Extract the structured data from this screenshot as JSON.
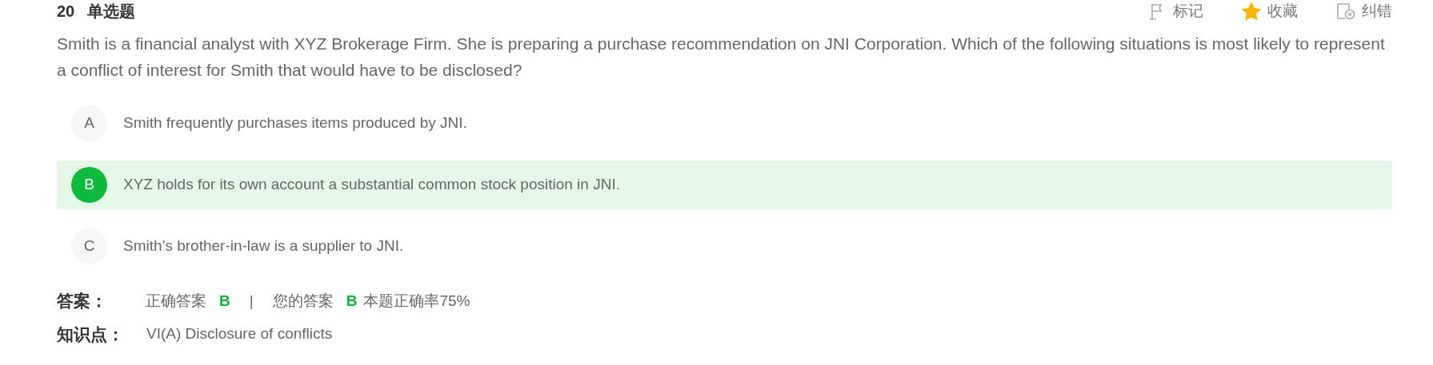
{
  "header": {
    "number": "20",
    "type": "单选题"
  },
  "actions": [
    {
      "kind": "flag",
      "label": "标记",
      "active": false
    },
    {
      "kind": "star",
      "label": "收藏",
      "active": true
    },
    {
      "kind": "report",
      "label": "纠错",
      "active": false
    }
  ],
  "question": "Smith is a financial analyst with XYZ Brokerage Firm. She is preparing a purchase recommendation on JNI Corporation. Which of the following situations is most likely to represent a conflict of interest for Smith that would have to be disclosed?",
  "options": [
    {
      "letter": "A",
      "text": "Smith frequently purchases items produced by JNI.",
      "selected": false
    },
    {
      "letter": "B",
      "text": "XYZ holds for its own account a substantial common stock position in JNI.",
      "selected": true
    },
    {
      "letter": "C",
      "text": "Smith’s brother-in-law is a supplier to JNI.",
      "selected": false
    }
  ],
  "answer": {
    "label": "答案：",
    "correct_label": "正确答案",
    "correct_value": "B",
    "separator": "|",
    "mine_label": "您的答案",
    "mine_value": "B",
    "rate": "本题正确率75%"
  },
  "knowledge": {
    "label": "知识点：",
    "value": "VI(A) Disclosure of conflicts"
  }
}
